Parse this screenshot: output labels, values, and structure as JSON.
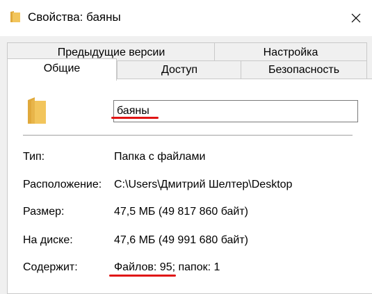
{
  "window": {
    "title": "Свойства: баяны",
    "close_glyph": "✕"
  },
  "tabs": {
    "row1": [
      "Предыдущие версии",
      "Настройка"
    ],
    "row2": [
      "Общие",
      "Доступ",
      "Безопасность"
    ],
    "active": "Общие"
  },
  "general": {
    "name_value": "баяны",
    "properties": [
      {
        "label": "Тип:",
        "value": "Папка с файлами"
      },
      {
        "label": "Расположение:",
        "value": "C:\\Users\\Дмитрий Шелтер\\Desktop"
      },
      {
        "label": "Размер:",
        "value": "47,5 МБ (49 817 860 байт)"
      },
      {
        "label": "На диске:",
        "value": "47,6 МБ (49 991 680 байт)"
      },
      {
        "label": "Содержит:",
        "value": "Файлов: 95; папок: 1"
      }
    ]
  },
  "icons": {
    "title_icon": "folder-icon",
    "big_icon": "folder-icon",
    "close_icon": "close-icon"
  },
  "colors": {
    "folder_yellow": "#f2c55c",
    "folder_dark": "#e0a93b",
    "annotation_red": "#e01414"
  }
}
